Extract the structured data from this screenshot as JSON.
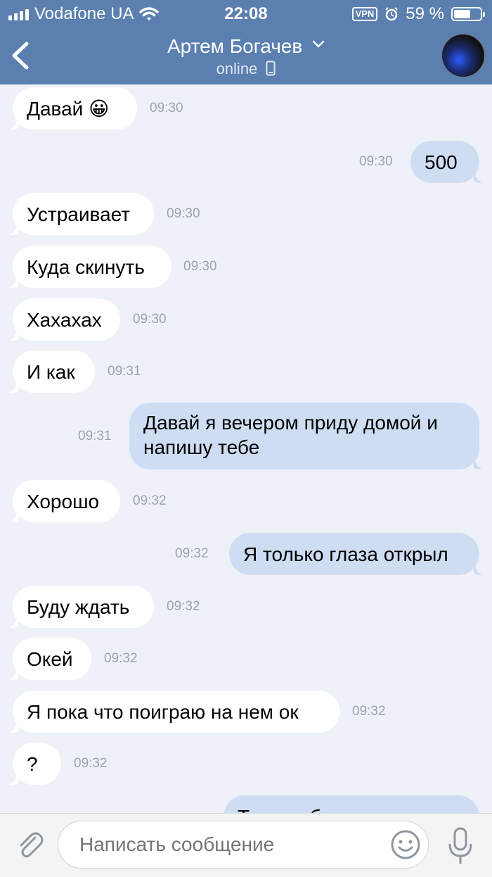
{
  "status": {
    "carrier": "Vodafone UA",
    "time": "22:08",
    "vpn": "VPN",
    "battery": "59 %"
  },
  "header": {
    "title": "Артем Богачев",
    "subtitle": "online"
  },
  "messages": [
    {
      "dir": "in",
      "text": "Давай 😀",
      "time": "09:30"
    },
    {
      "dir": "out",
      "text": "500",
      "time": "09:30"
    },
    {
      "dir": "in",
      "text": "Устраивает",
      "time": "09:30"
    },
    {
      "dir": "in",
      "text": "Куда скинуть",
      "time": "09:30"
    },
    {
      "dir": "in",
      "text": "Хахахах",
      "time": "09:30"
    },
    {
      "dir": "in",
      "text": "И как",
      "time": "09:31"
    },
    {
      "dir": "out",
      "text": "Давай я вечером приду домой и напишу тебе",
      "time": "09:31"
    },
    {
      "dir": "in",
      "text": "Хорошо",
      "time": "09:32"
    },
    {
      "dir": "out",
      "text": "Я только глаза открыл",
      "time": "09:32"
    },
    {
      "dir": "in",
      "text": "Буду ждать",
      "time": "09:32"
    },
    {
      "dir": "in",
      "text": "Окей",
      "time": "09:32"
    },
    {
      "dir": "in",
      "text": "Я пока что поиграю на нем ок",
      "time": "09:32"
    },
    {
      "dir": "in",
      "text": "?",
      "time": "09:32"
    },
    {
      "dir": "out",
      "text": "Так а тебе же твое тел",
      "time": ""
    }
  ],
  "composer": {
    "placeholder": "Написать сообщение"
  },
  "colors": {
    "header_bg": "#5b80b0",
    "chat_bg": "#eef2f8",
    "bubble_in": "#ffffff",
    "bubble_out": "#cfddf2"
  }
}
